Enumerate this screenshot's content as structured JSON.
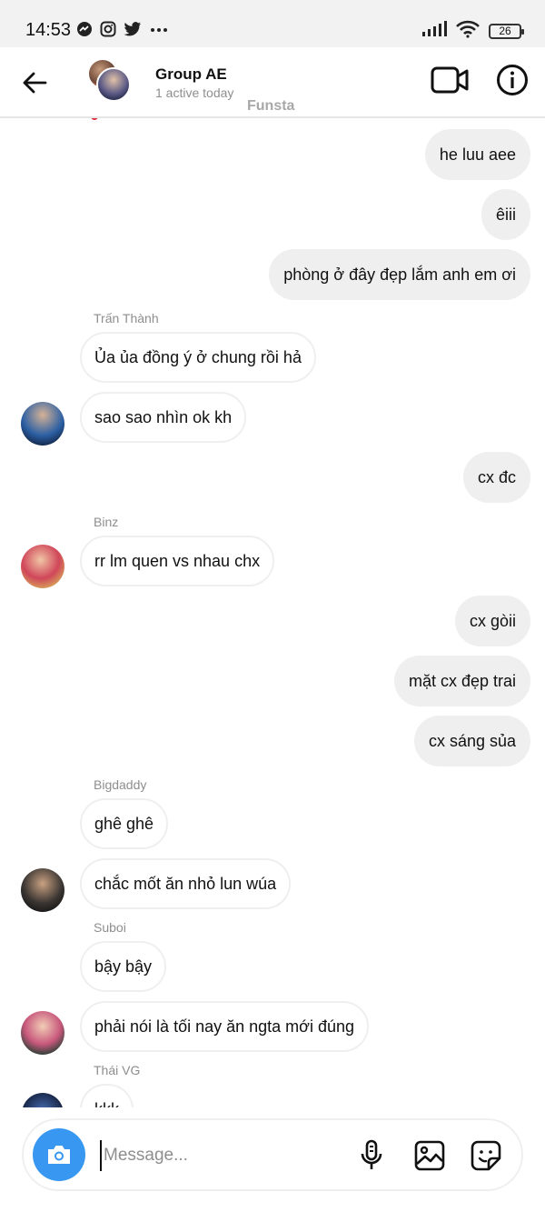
{
  "status_bar": {
    "time": "14:53",
    "battery": "26",
    "left_icons": [
      "messenger-icon",
      "instagram-icon",
      "twitter-icon",
      "more-dots-icon"
    ],
    "right_icons": [
      "signal-icon",
      "wifi-icon",
      "battery-icon"
    ]
  },
  "header": {
    "title": "Group AE",
    "subtitle": "1 active today",
    "watermark": "Funsta",
    "icons": [
      "back-arrow-icon",
      "group-avatar-icon",
      "video-call-icon",
      "info-icon"
    ]
  },
  "messages": [
    {
      "dir": "out",
      "text": "he luu aee"
    },
    {
      "dir": "out",
      "text": "êiii"
    },
    {
      "dir": "out",
      "text": "phòng ở đây đẹp lắm anh em ơi"
    },
    {
      "dir": "in",
      "sender": "Trấn Thành",
      "text": "Ủa ủa đồng ý ở chung rồi hả"
    },
    {
      "dir": "in",
      "text": "sao sao nhìn ok kh"
    },
    {
      "dir": "out",
      "text": "cx đc"
    },
    {
      "dir": "in",
      "sender": "Binz",
      "text": "rr  lm quen vs nhau chx"
    },
    {
      "dir": "out",
      "text": "cx gòii"
    },
    {
      "dir": "out",
      "text": "mặt cx đẹp trai"
    },
    {
      "dir": "out",
      "text": "cx sáng sủa"
    },
    {
      "dir": "in",
      "sender": "Bigdaddy",
      "text": "ghê ghê"
    },
    {
      "dir": "in",
      "text": "chắc mốt ăn nhỏ lun wúa"
    },
    {
      "dir": "in",
      "sender": "Suboi",
      "text": "bậy bậy"
    },
    {
      "dir": "in",
      "text": "phải nói là tối nay ăn ngta mới đúng"
    },
    {
      "dir": "in",
      "sender": "Thái VG",
      "text": "kkk"
    }
  ],
  "composer": {
    "placeholder": "Message...",
    "value": "",
    "icons": [
      "camera-icon",
      "microphone-icon",
      "gallery-icon",
      "sticker-icon"
    ]
  },
  "colors": {
    "accent": "#3897f0",
    "outgoing_bubble": "#efefef",
    "incoming_border": "#efefef",
    "secondary_text": "#8e8e8e",
    "reaction_dot": "#e0323e"
  }
}
